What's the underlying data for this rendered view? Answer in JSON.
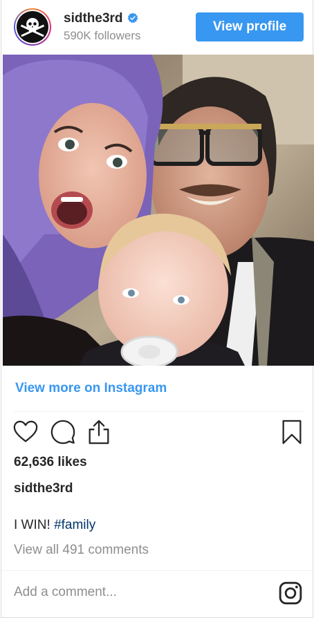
{
  "header": {
    "username": "sidthe3rd",
    "followers": "590K followers",
    "view_profile_label": "View profile"
  },
  "post": {
    "view_more_label": "View more on Instagram",
    "likes": "62,636 likes",
    "owner": "sidthe3rd",
    "caption_text": "I WIN! ",
    "hashtag": "#family",
    "view_comments": "View all 491 comments",
    "add_comment_placeholder": "Add a comment..."
  },
  "icons": {
    "like": "heart-icon",
    "comment": "comment-icon",
    "share": "share-icon",
    "save": "bookmark-icon",
    "instagram": "instagram-icon",
    "verified": "verified-badge-icon"
  },
  "colors": {
    "button_blue": "#3897f0",
    "hashtag": "#003569",
    "muted": "#8e8e8e",
    "text": "#262626"
  }
}
